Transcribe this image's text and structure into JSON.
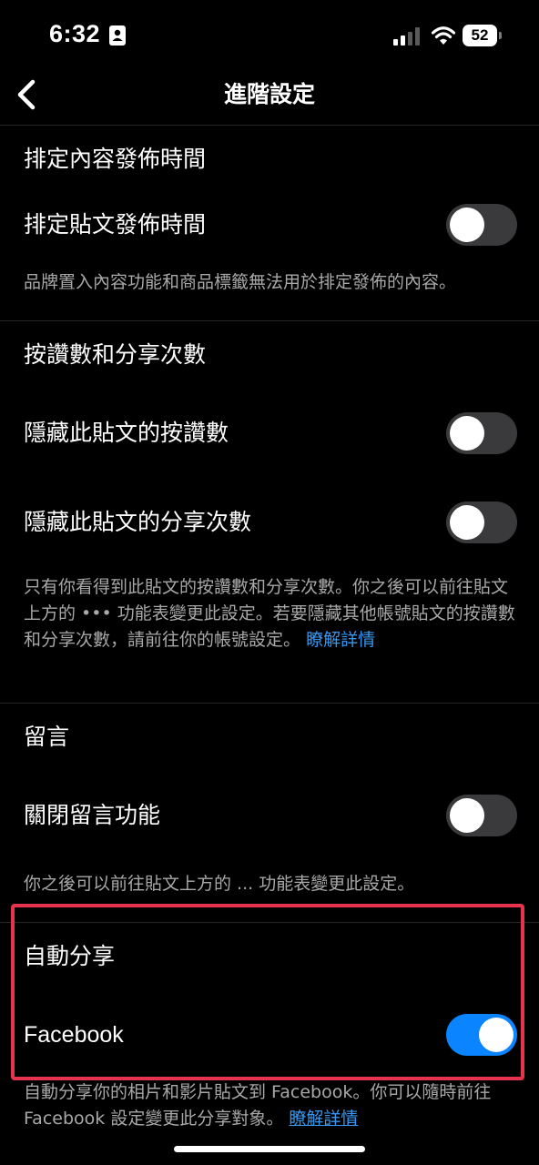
{
  "status_bar": {
    "time": "6:32",
    "battery_level": "52",
    "icons": [
      "person-badge-icon",
      "signal-icon",
      "wifi-icon",
      "battery-icon"
    ]
  },
  "nav": {
    "back_icon": "chevron-left-icon",
    "title": "進階設定"
  },
  "sections": {
    "schedule": {
      "title": "排定內容發佈時間",
      "row_label": "排定貼文發佈時間",
      "toggle_on": false,
      "helper": "品牌置入內容功能和商品標籤無法用於排定發佈的內容。"
    },
    "likes": {
      "title": "按讚數和分享次數",
      "rows": [
        {
          "label": "隱藏此貼文的按讚數",
          "toggle_on": false
        },
        {
          "label": "隱藏此貼文的分享次數",
          "toggle_on": false
        }
      ],
      "helper": "只有你看得到此貼文的按讚數和分享次數。你之後可以前往貼文上方的 ••• 功能表變更此設定。若要隱藏其他帳號貼文的按讚數和分享次數，請前往你的帳號設定。",
      "helper_link": "瞭解詳情"
    },
    "comments": {
      "title": "留言",
      "row_label": "關閉留言功能",
      "toggle_on": false,
      "helper": "你之後可以前往貼文上方的 ... 功能表變更此設定。"
    },
    "auto_share": {
      "title": "自動分享",
      "row_label": "Facebook",
      "toggle_on": true,
      "helper": "自動分享你的相片和影片貼文到 Facebook。你可以隨時前往 Facebook 設定變更此分享對象。",
      "helper_link": "瞭解詳情"
    }
  },
  "colors": {
    "background": "#000000",
    "toggle_off": "#3a3a3c",
    "toggle_on": "#0a84ff",
    "link": "#3797f0",
    "highlight": "#e8334d",
    "secondary_text": "#a8a8a8"
  }
}
